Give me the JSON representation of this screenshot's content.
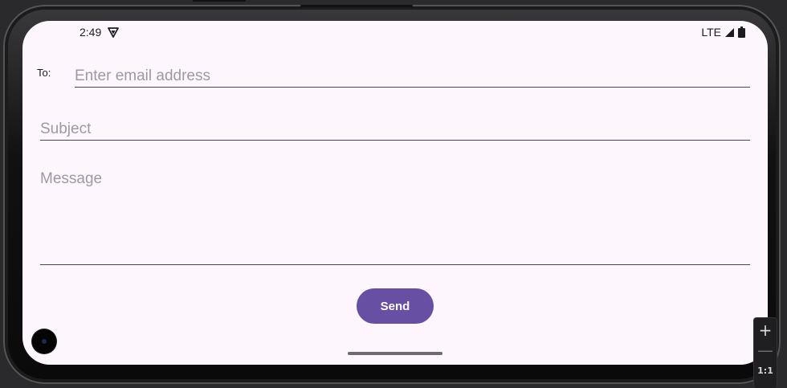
{
  "status_bar": {
    "time": "2:49",
    "network": "LTE",
    "icons": [
      "vpn-key-icon",
      "signal-icon",
      "battery-icon"
    ]
  },
  "form": {
    "to_label": "To:",
    "to_placeholder": "Enter email address",
    "to_value": "",
    "subject_placeholder": "Subject",
    "subject_value": "",
    "message_placeholder": "Message",
    "message_value": "",
    "send_label": "Send"
  },
  "emulator_controls": {
    "zoom_in": "+",
    "zoom_out": "—",
    "zoom_reset": "1:1"
  },
  "colors": {
    "accent": "#6750a4",
    "background": "#fdf7fd",
    "placeholder": "#9d98a4"
  }
}
